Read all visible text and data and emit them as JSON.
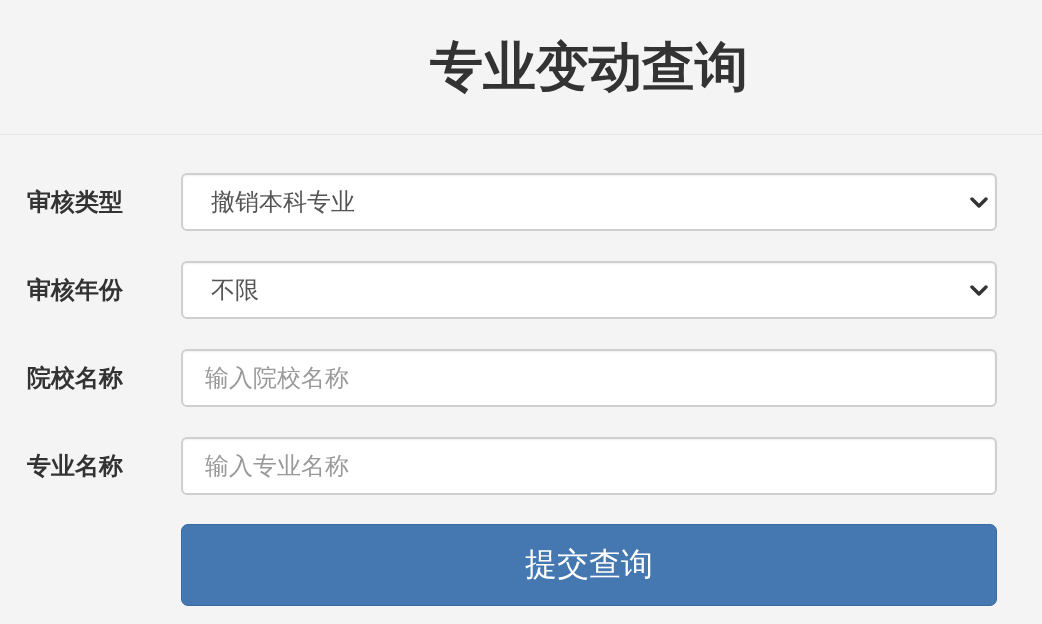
{
  "header": {
    "title": "专业变动查询"
  },
  "form": {
    "fields": [
      {
        "kind": "select",
        "label": "审核类型",
        "value": "撤销本科专业"
      },
      {
        "kind": "select",
        "label": "审核年份",
        "value": "不限"
      },
      {
        "kind": "text",
        "label": "院校名称",
        "placeholder": "输入院校名称"
      },
      {
        "kind": "text",
        "label": "专业名称",
        "placeholder": "输入专业名称"
      }
    ],
    "submit_button": "提交查询"
  }
}
